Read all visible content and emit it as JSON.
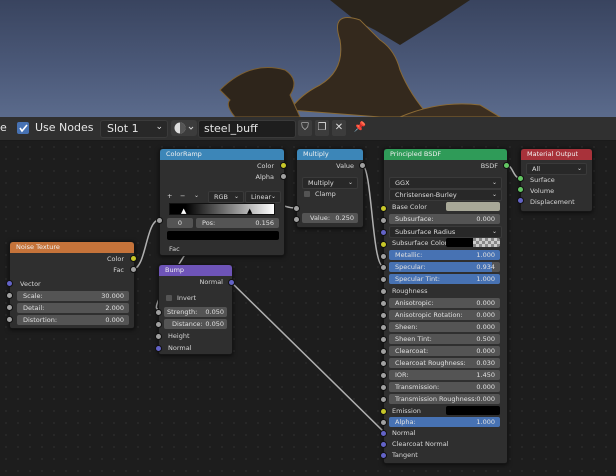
{
  "header": {
    "partial_label": "e",
    "use_nodes": "Use Nodes",
    "slot": "Slot 1",
    "material_name": "steel_buff"
  },
  "noise": {
    "title": "Noise Texture",
    "out_color": "Color",
    "out_fac": "Fac",
    "in_vector": "Vector",
    "scale_label": "Scale:",
    "scale_value": "30.000",
    "detail_label": "Detail:",
    "detail_value": "2.000",
    "distortion_label": "Distortion:",
    "distortion_value": "0.000"
  },
  "colorramp": {
    "title": "ColorRamp",
    "out_color": "Color",
    "out_alpha": "Alpha",
    "plus": "+",
    "minus": "−",
    "mode": "RGB",
    "interp": "Linear",
    "index": "0",
    "pos_label": "Pos:",
    "pos_value": "0.156",
    "in_fac": "Fac"
  },
  "bump": {
    "title": "Bump",
    "out_normal": "Normal",
    "invert": "Invert",
    "strength_label": "Strength:",
    "strength_value": "0.050",
    "distance_label": "Distance:",
    "distance_value": "0.050",
    "height": "Height",
    "normal": "Normal"
  },
  "multiply": {
    "title": "Multiply",
    "out_value": "Value",
    "op": "Multiply",
    "clamp": "Clamp",
    "value_label": "Value:",
    "value_value": "0.250"
  },
  "bsdf": {
    "title": "Principled BSDF",
    "out": "BSDF",
    "dist": "GGX",
    "sss_method": "Christensen-Burley",
    "base_color": "Base Color",
    "subsurface_label": "Subsurface:",
    "subsurface_value": "0.000",
    "subsurface_radius": "Subsurface Radius",
    "subsurface_color": "Subsurface Color",
    "metallic_label": "Metallic:",
    "metallic_value": "1.000",
    "specular_label": "Specular:",
    "specular_value": "0.934",
    "spectint_label": "Specular Tint:",
    "spectint_value": "1.000",
    "roughness": "Roughness",
    "aniso_label": "Anisotropic:",
    "aniso_value": "0.000",
    "anisorot_label": "Anisotropic Rotation:",
    "anisorot_value": "0.000",
    "sheen_label": "Sheen:",
    "sheen_value": "0.000",
    "sheentint_label": "Sheen Tint:",
    "sheentint_value": "0.500",
    "clearcoat_label": "Clearcoat:",
    "clearcoat_value": "0.000",
    "ccrough_label": "Clearcoat Roughness:",
    "ccrough_value": "0.030",
    "ior_label": "IOR:",
    "ior_value": "1.450",
    "transmission_label": "Transmission:",
    "transmission_value": "0.000",
    "transrough_label": "Transmission Roughness:",
    "transrough_value": "0.000",
    "emission": "Emission",
    "alpha_label": "Alpha:",
    "alpha_value": "1.000",
    "normal": "Normal",
    "clearcoat_normal": "Clearcoat Normal",
    "tangent": "Tangent"
  },
  "output": {
    "title": "Material Output",
    "target": "All",
    "surface": "Surface",
    "volume": "Volume",
    "displacement": "Displacement"
  },
  "colors": {
    "node_bg": "#2f2f2f",
    "header_texture": "#c5733a",
    "header_converter": "#3c86b8",
    "header_shader": "#2f9b58",
    "header_vector": "#6e54b8",
    "header_output": "#a8323a",
    "accent": "#4772b3"
  }
}
